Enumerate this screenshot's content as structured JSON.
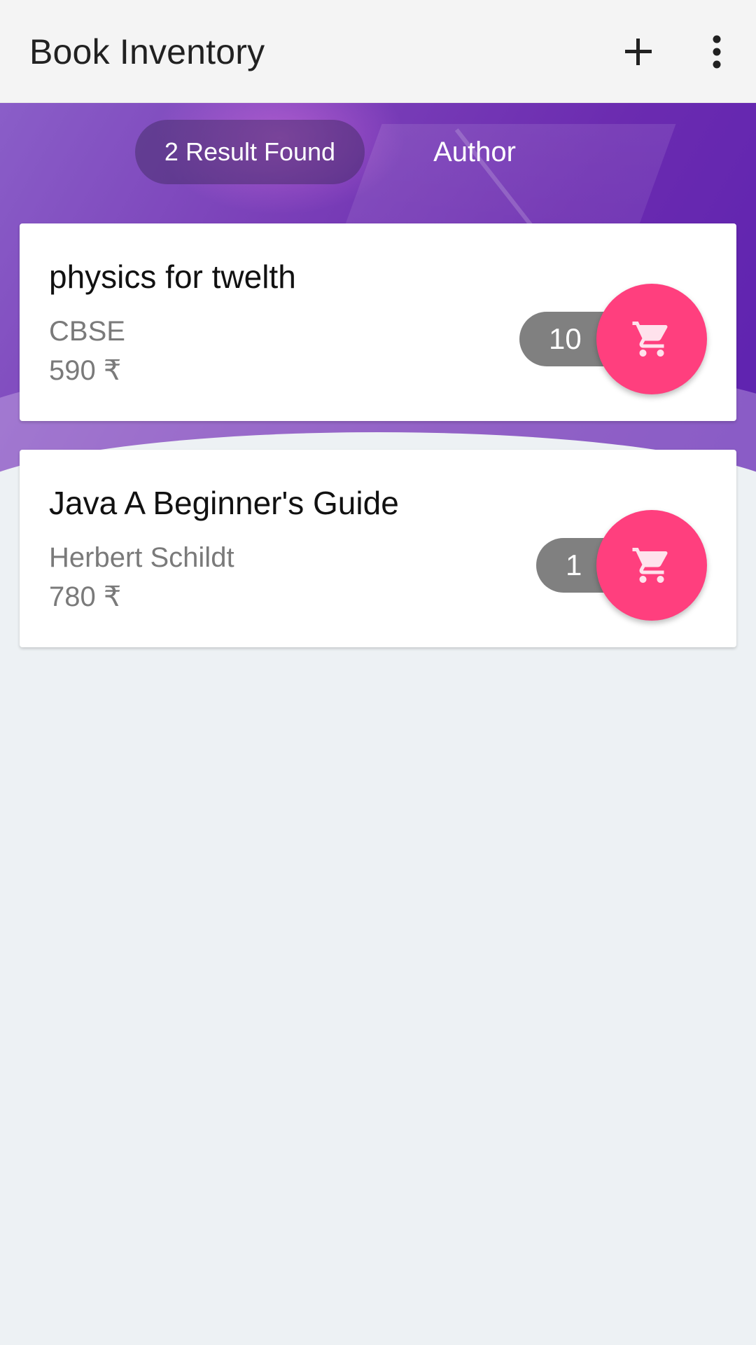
{
  "appbar": {
    "title": "Book Inventory",
    "add_icon": "plus-icon",
    "more_icon": "more-vert-icon"
  },
  "filters": {
    "results_label": "2 Result Found",
    "author_label": "Author"
  },
  "books": [
    {
      "title": "physics for twelth",
      "author": "CBSE",
      "price": "590 ₹",
      "quantity": "10",
      "cart_icon": "cart-icon"
    },
    {
      "title": "Java A Beginner's Guide",
      "author": "Herbert Schildt",
      "price": "780 ₹",
      "quantity": "1",
      "cart_icon": "cart-icon"
    }
  ],
  "colors": {
    "accent": "#ff3f7e",
    "badge": "#808080",
    "hero_start": "#8a5ec8",
    "hero_end": "#5d22b0",
    "background": "#edf1f4"
  }
}
